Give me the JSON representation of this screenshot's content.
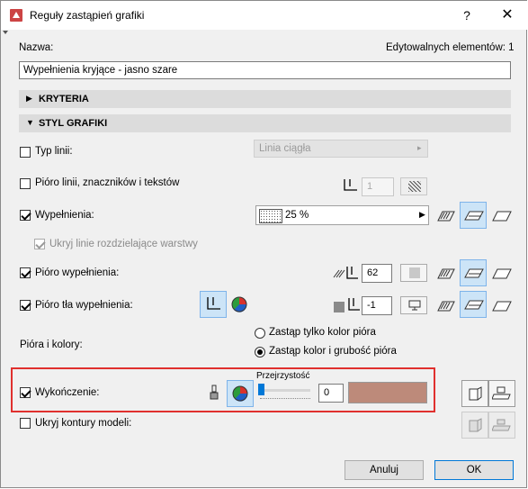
{
  "window": {
    "title": "Reguły zastąpień grafiki",
    "help_label": "?",
    "close_label": "✕"
  },
  "name_label": "Nazwa:",
  "editable_label": "Edytowalnych elementów: 1",
  "name_value": "Wypełnienia kryjące - jasno szare",
  "sections": {
    "criteria": "KRYTERIA",
    "style": "STYL GRAFIKI"
  },
  "rows": {
    "line_type": {
      "label": "Typ linii:",
      "checked": false,
      "value": "Linia ciągła"
    },
    "line_pen": {
      "label": "Pióro linii, znaczników i tekstów",
      "checked": false,
      "pen_value": "1"
    },
    "fill": {
      "label": "Wypełnienia:",
      "checked": true,
      "value": "25 %"
    },
    "hide_lines": {
      "label": "Ukryj linie rozdzielające warstwy",
      "checked": true,
      "disabled": true
    },
    "fill_pen": {
      "label": "Pióro wypełnienia:",
      "checked": true,
      "pen_value": "62"
    },
    "bg_pen": {
      "label": "Pióro tła wypełnienia:",
      "checked": true,
      "pen_value": "-1"
    },
    "pens_colors": {
      "label": "Pióra i kolory:"
    },
    "finish": {
      "label": "Wykończenie:",
      "checked": true,
      "transparency_label": "Przejrzystość",
      "transparency_value": "0",
      "swatch_color": "#bd8a7a"
    },
    "hide_contours": {
      "label": "Ukryj kontury modeli:",
      "checked": false
    }
  },
  "radio": {
    "color_only": {
      "label": "Zastąp tylko kolor pióra",
      "selected": false
    },
    "color_weight": {
      "label": "Zastąp kolor i grubość pióra",
      "selected": true
    }
  },
  "buttons": {
    "cancel": "Anuluj",
    "ok": "OK"
  },
  "colors": {
    "accent": "#0078d7",
    "highlight": "#e0302e"
  }
}
